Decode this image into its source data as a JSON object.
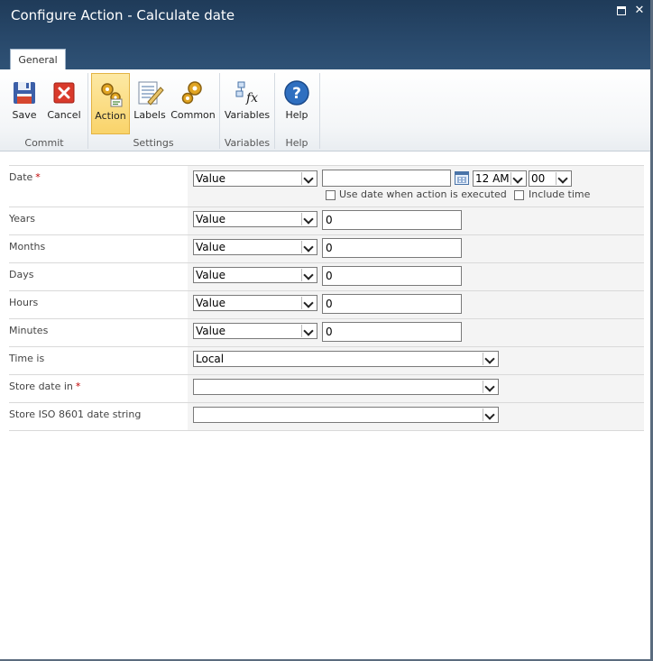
{
  "window": {
    "title": "Configure Action - Calculate date"
  },
  "ribbon": {
    "tab": "General",
    "buttons": {
      "save": "Save",
      "cancel": "Cancel",
      "action": "Action",
      "labels": "Labels",
      "common": "Common",
      "variables": "Variables",
      "help": "Help"
    },
    "groups": {
      "commit": "Commit",
      "settings": "Settings",
      "variables": "Variables",
      "help": "Help"
    }
  },
  "form": {
    "required_mark": "*",
    "date": {
      "label": "Date",
      "type": "Value",
      "value": "",
      "hour": "12 AM",
      "minute": "00",
      "use_exec_label": "Use date when action is executed",
      "include_time_label": "Include time"
    },
    "years": {
      "label": "Years",
      "type": "Value",
      "value": "0"
    },
    "months": {
      "label": "Months",
      "type": "Value",
      "value": "0"
    },
    "days": {
      "label": "Days",
      "type": "Value",
      "value": "0"
    },
    "hours": {
      "label": "Hours",
      "type": "Value",
      "value": "0"
    },
    "minutes": {
      "label": "Minutes",
      "type": "Value",
      "value": "0"
    },
    "time_is": {
      "label": "Time is",
      "value": "Local"
    },
    "store_date": {
      "label": "Store date in",
      "value": ""
    },
    "store_iso": {
      "label": "Store ISO 8601 date string",
      "value": ""
    }
  }
}
